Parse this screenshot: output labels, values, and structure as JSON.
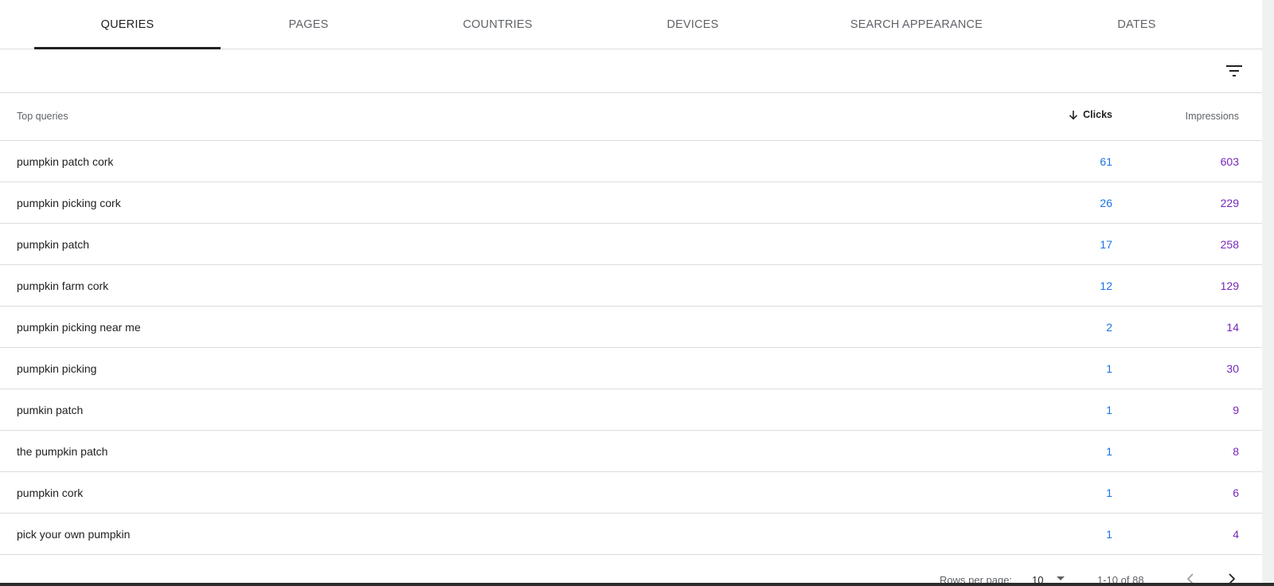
{
  "tabs": [
    {
      "label": "QUERIES",
      "active": true
    },
    {
      "label": "PAGES",
      "active": false
    },
    {
      "label": "COUNTRIES",
      "active": false
    },
    {
      "label": "DEVICES",
      "active": false
    },
    {
      "label": "SEARCH APPEARANCE",
      "active": false
    },
    {
      "label": "DATES",
      "active": false
    }
  ],
  "filter": {
    "icon": "filter-icon"
  },
  "table": {
    "header": {
      "query": "Top queries",
      "clicks": "Clicks",
      "impressions": "Impressions",
      "sort_icon": "arrow-down-icon"
    },
    "rows": [
      {
        "query": "pumpkin patch cork",
        "clicks": "61",
        "impressions": "603"
      },
      {
        "query": "pumpkin picking cork",
        "clicks": "26",
        "impressions": "229"
      },
      {
        "query": "pumpkin patch",
        "clicks": "17",
        "impressions": "258"
      },
      {
        "query": "pumpkin farm cork",
        "clicks": "12",
        "impressions": "129"
      },
      {
        "query": "pumpkin picking near me",
        "clicks": "2",
        "impressions": "14"
      },
      {
        "query": "pumpkin picking",
        "clicks": "1",
        "impressions": "30"
      },
      {
        "query": "pumkin patch",
        "clicks": "1",
        "impressions": "9"
      },
      {
        "query": "the pumpkin patch",
        "clicks": "1",
        "impressions": "8"
      },
      {
        "query": "pumpkin cork",
        "clicks": "1",
        "impressions": "6"
      },
      {
        "query": "pick your own pumpkin",
        "clicks": "1",
        "impressions": "4"
      }
    ]
  },
  "pagination": {
    "rows_per_page_label": "Rows per page:",
    "rows_per_page_value": "10",
    "range": "1-10 of 88"
  },
  "colors": {
    "clicks": "#1a73e8",
    "impressions": "#7627bb",
    "active_tab_indicator": "#202124"
  }
}
